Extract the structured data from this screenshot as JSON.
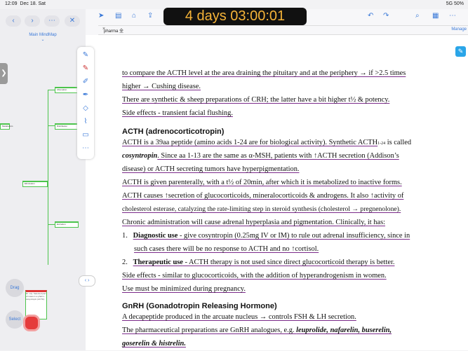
{
  "status": {
    "time": "12:09",
    "date": "Dec 18. Sat",
    "right": "5G 50%"
  },
  "left": {
    "mindmap_title": "Main MindMap",
    "drag": "Drag",
    "select": "Select",
    "nodes": [
      "Absorption",
      "Distribution",
      "Metabolism",
      "Elimination",
      "Excretion"
    ],
    "card_text": "Dr. Lily: Selected part of notes in a pharm... cosyntropin (ACTH)"
  },
  "timer": "4 days 03:00:01",
  "tab": {
    "label": "pharma 全",
    "manage": "Manage"
  },
  "doc": {
    "p1_a": "to compare the ACTH level at the area draining the pituitary and at the periphery → if >2.5 times",
    "p1_b": "higher → Cushing disease.",
    "p2": "There are synthetic & sheep preparations of CRH; the latter have a bit higher t½ & potency.",
    "p3": "Side effects - transient facial flushing.",
    "h1": "ACTH (adrenocorticotropin)",
    "p4_a": "ACTH is a 39aa peptide (amino acids 1-24 are for biological activity). Synthetic ACTH",
    "p4_sub": "1-24",
    "p4_b": " is called",
    "p4_c": "cosyntropin",
    "p4_d": ". Since aa 1-13 are the same as α-MSH, patients with ↑ACTH secretion (Addison’s",
    "p4_e": "disease) or ACTH secreting tumors have hyperpigmentation.",
    "p5": "ACTH is given parenterally, with a t½ of 20min, after which it is metabolized to inactive forms.",
    "p6_a": "ACTH causes ↑secretion of glucocorticoids, mineralocorticoids & androgens. It also ↑activity of",
    "p6_b": "cholesterol esterase, catalyzing the rate-limiting step in steroid synthesis (cholesterol → pregnenolone).",
    "p7": "Chronic administration will cause adrenal hyperplasia and pigmentation. Clinically, it has:",
    "li1_num": "1.",
    "li1_bold": "Diagnostic use",
    "li1_a": " - give cosyntropin (0.25mg IV or IM) to rule out adrenal insufficiency, since in",
    "li1_b": "such cases there will be no response to ACTH and no ↑cortisol.",
    "li2_num": "2.",
    "li2_bold": "Therapeutic use",
    "li2_a": " - ACTH therapy is not used since direct glucocorticoid therapy is better.",
    "p8": "Side effects - similar to glucocorticoids, with the addition of hyperandrogenism in women.",
    "p9": "Use must be minimized during pregnancy.",
    "h2": "GnRH (Gonadotropin Releasing Hormone)",
    "p10": "A decapeptide produced in the arcuate nucleus → controls FSH & LH secretion.",
    "p11_a": "The pharmaceutical preparations are GnRH analogues, e.g. ",
    "p11_b": "leuprolide, nafarelin, buserelin,",
    "p12": "goserelin & histrelin."
  },
  "colors": {
    "accent": "#3a79d8",
    "annotation": "#7b2a8a",
    "timer_text": "#f5b338"
  }
}
